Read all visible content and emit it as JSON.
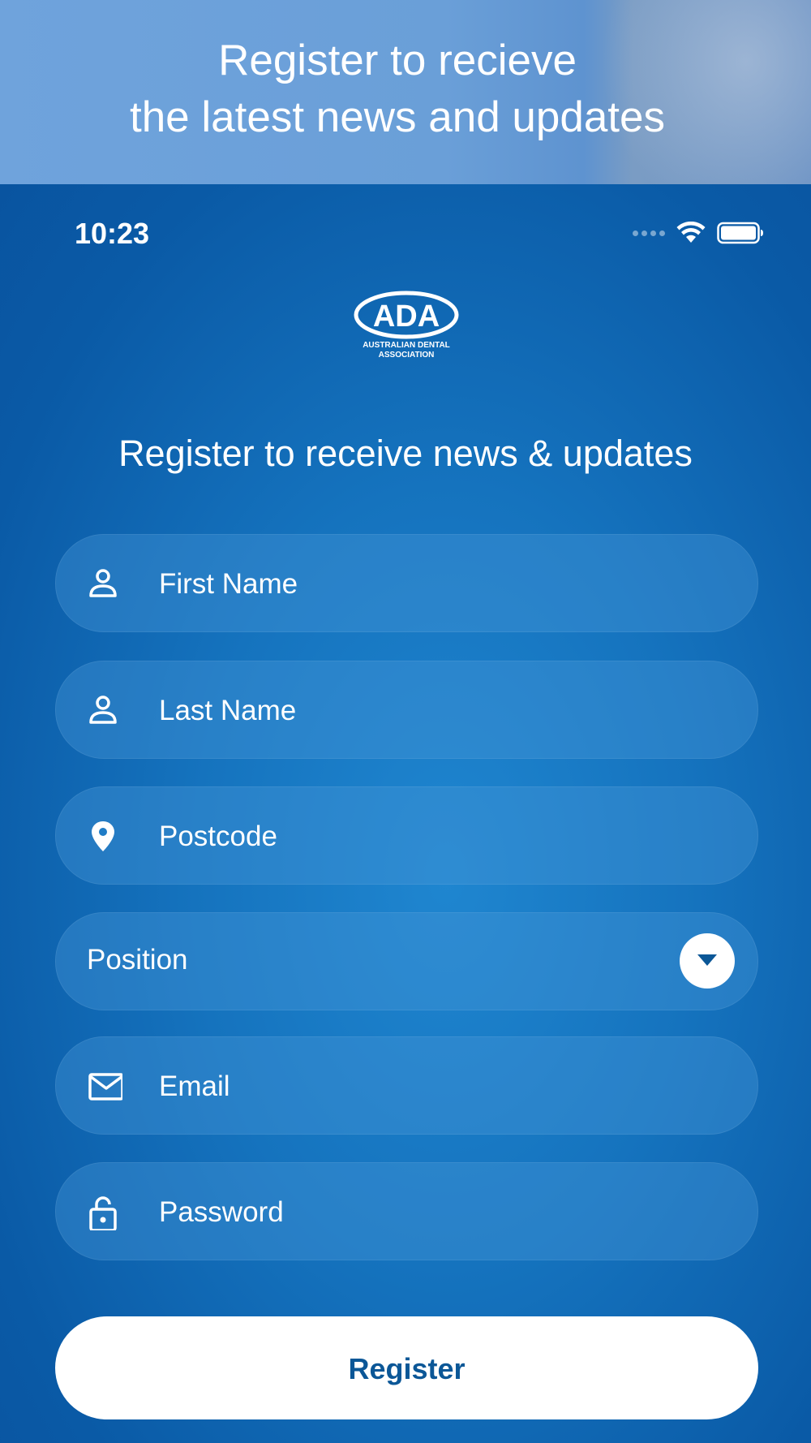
{
  "banner": {
    "line1": "Register to recieve",
    "line2": "the latest news and updates"
  },
  "status_bar": {
    "time": "10:23",
    "icons": [
      "signal-dots-icon",
      "wifi-icon",
      "battery-icon"
    ]
  },
  "logo": {
    "mark": "ADA",
    "line1": "AUSTRALIAN DENTAL",
    "line2": "ASSOCIATION"
  },
  "form": {
    "title": "Register to receive news & updates",
    "fields": [
      {
        "placeholder": "First Name",
        "icon": "person-icon"
      },
      {
        "placeholder": "Last Name",
        "icon": "person-icon"
      },
      {
        "placeholder": "Postcode",
        "icon": "location-pin-icon"
      },
      {
        "placeholder": "Position",
        "icon": "chevron-down-icon"
      },
      {
        "placeholder": "Email",
        "icon": "mail-icon"
      },
      {
        "placeholder": "Password",
        "icon": "lock-icon"
      }
    ],
    "register_label": "Register"
  },
  "colors": {
    "background": "#0b5fa8",
    "button_text": "#0b5797",
    "banner": "#6fa3dc"
  }
}
